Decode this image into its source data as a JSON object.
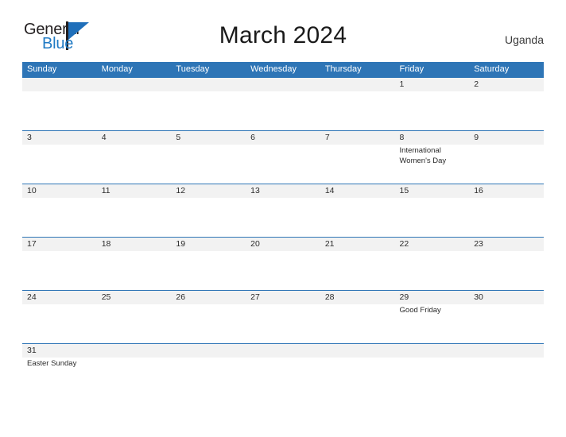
{
  "brand": {
    "name_part1": "General",
    "name_part2": "Blue",
    "flag_icon": "blue-triangle-flag-icon",
    "primary_color": "#1f6fba",
    "text_color": "#231f20"
  },
  "header": {
    "title": "March 2024",
    "country": "Uganda"
  },
  "calendar": {
    "header_bg_color": "#2e75b6",
    "date_band_color": "#f2f2f2",
    "weekday_headers": [
      "Sunday",
      "Monday",
      "Tuesday",
      "Wednesday",
      "Thursday",
      "Friday",
      "Saturday"
    ],
    "weeks": [
      {
        "days": [
          {
            "date": "",
            "event": ""
          },
          {
            "date": "",
            "event": ""
          },
          {
            "date": "",
            "event": ""
          },
          {
            "date": "",
            "event": ""
          },
          {
            "date": "",
            "event": ""
          },
          {
            "date": "1",
            "event": ""
          },
          {
            "date": "2",
            "event": ""
          }
        ]
      },
      {
        "days": [
          {
            "date": "3",
            "event": ""
          },
          {
            "date": "4",
            "event": ""
          },
          {
            "date": "5",
            "event": ""
          },
          {
            "date": "6",
            "event": ""
          },
          {
            "date": "7",
            "event": ""
          },
          {
            "date": "8",
            "event": "International Women's Day"
          },
          {
            "date": "9",
            "event": ""
          }
        ]
      },
      {
        "days": [
          {
            "date": "10",
            "event": ""
          },
          {
            "date": "11",
            "event": ""
          },
          {
            "date": "12",
            "event": ""
          },
          {
            "date": "13",
            "event": ""
          },
          {
            "date": "14",
            "event": ""
          },
          {
            "date": "15",
            "event": ""
          },
          {
            "date": "16",
            "event": ""
          }
        ]
      },
      {
        "days": [
          {
            "date": "17",
            "event": ""
          },
          {
            "date": "18",
            "event": ""
          },
          {
            "date": "19",
            "event": ""
          },
          {
            "date": "20",
            "event": ""
          },
          {
            "date": "21",
            "event": ""
          },
          {
            "date": "22",
            "event": ""
          },
          {
            "date": "23",
            "event": ""
          }
        ]
      },
      {
        "days": [
          {
            "date": "24",
            "event": ""
          },
          {
            "date": "25",
            "event": ""
          },
          {
            "date": "26",
            "event": ""
          },
          {
            "date": "27",
            "event": ""
          },
          {
            "date": "28",
            "event": ""
          },
          {
            "date": "29",
            "event": "Good Friday"
          },
          {
            "date": "30",
            "event": ""
          }
        ]
      },
      {
        "days": [
          {
            "date": "31",
            "event": "Easter Sunday"
          },
          {
            "date": "",
            "event": ""
          },
          {
            "date": "",
            "event": ""
          },
          {
            "date": "",
            "event": ""
          },
          {
            "date": "",
            "event": ""
          },
          {
            "date": "",
            "event": ""
          },
          {
            "date": "",
            "event": ""
          }
        ]
      }
    ]
  }
}
